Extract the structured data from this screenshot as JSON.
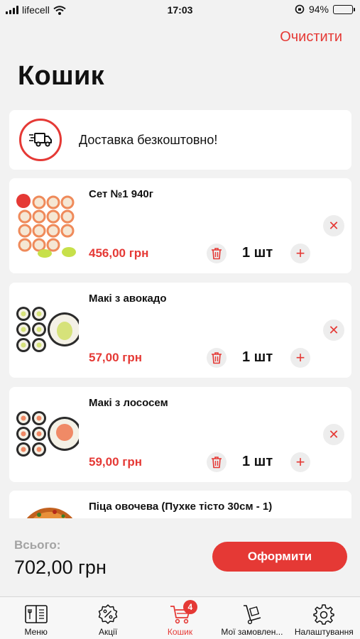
{
  "status_bar": {
    "carrier": "lifecell",
    "time": "17:03",
    "battery": "94%"
  },
  "header": {
    "clear_label": "Очистити",
    "title": "Кошик"
  },
  "delivery": {
    "text": "Доставка безкоштовно!",
    "icon": "truck-icon"
  },
  "cart_items": [
    {
      "name": "Сет №1 940г",
      "price": "456,00 грн",
      "quantity": "1 шт"
    },
    {
      "name": "Макі з авокадо",
      "price": "57,00 грн",
      "quantity": "1 шт"
    },
    {
      "name": "Макі з лососем",
      "price": "59,00 грн",
      "quantity": "1 шт"
    },
    {
      "name": "Піца овочева (Пухке тісто 30см - 1)"
    }
  ],
  "summary": {
    "total_label": "Всього:",
    "total_value": "702,00 грн",
    "checkout_label": "Оформити"
  },
  "tabbar": {
    "tabs": [
      {
        "label": "Меню",
        "icon": "menu-book-icon"
      },
      {
        "label": "Акції",
        "icon": "discount-icon"
      },
      {
        "label": "Кошик",
        "icon": "cart-icon",
        "badge": "4",
        "active": true
      },
      {
        "label": "Мої замовлен...",
        "icon": "hand-truck-icon"
      },
      {
        "label": "Налаштування",
        "icon": "gear-icon"
      }
    ]
  },
  "colors": {
    "accent": "#e53935",
    "background": "#f2f2f2",
    "card": "#ffffff"
  }
}
